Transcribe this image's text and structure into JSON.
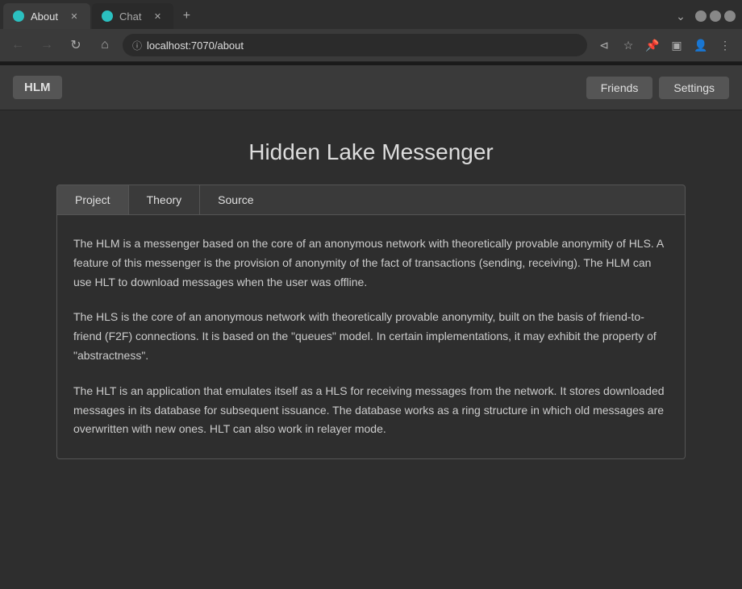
{
  "browser": {
    "tabs": [
      {
        "id": "about",
        "label": "About",
        "active": true,
        "favicon_color": "teal"
      },
      {
        "id": "chat",
        "label": "Chat",
        "active": false,
        "favicon_color": "teal"
      }
    ],
    "tab_add_icon": "+",
    "tab_overflow_icon": "⌄",
    "window_buttons": {
      "minimize": "−",
      "restore": "⤢",
      "close": "✕"
    },
    "nav": {
      "back_icon": "←",
      "forward_icon": "→",
      "reload_icon": "↻",
      "home_icon": "⌂"
    },
    "address": {
      "lock_icon": "ⓘ",
      "url": "localhost:7070/about"
    },
    "address_actions": {
      "share_icon": "⊲",
      "bookmark_icon": "☆",
      "pin_icon": "📌",
      "split_icon": "▣",
      "profile_icon": "👤",
      "menu_icon": "⋮"
    }
  },
  "app": {
    "brand": "HLM",
    "nav_buttons": [
      {
        "id": "friends",
        "label": "Friends"
      },
      {
        "id": "settings",
        "label": "Settings"
      }
    ],
    "page_title": "Hidden Lake Messenger",
    "tabs": [
      {
        "id": "project",
        "label": "Project",
        "active": true
      },
      {
        "id": "theory",
        "label": "Theory",
        "active": false
      },
      {
        "id": "source",
        "label": "Source",
        "active": false
      }
    ],
    "paragraphs": [
      "The HLM is a messenger based on the core of an anonymous network with theoretically provable anonymity of HLS. A feature of this messenger is the provision of anonymity of the fact of transactions (sending, receiving). The HLM can use HLT to download messages when the user was offline.",
      "The HLS is the core of an anonymous network with theoretically provable anonymity, built on the basis of friend-to-friend (F2F) connections. It is based on the \"queues\" model. In certain implementations, it may exhibit the property of \"abstractness\".",
      "The HLT is an application that emulates itself as a HLS for receiving messages from the network. It stores downloaded messages in its database for subsequent issuance. The database works as a ring structure in which old messages are overwritten with new ones. HLT can also work in relayer mode."
    ]
  }
}
